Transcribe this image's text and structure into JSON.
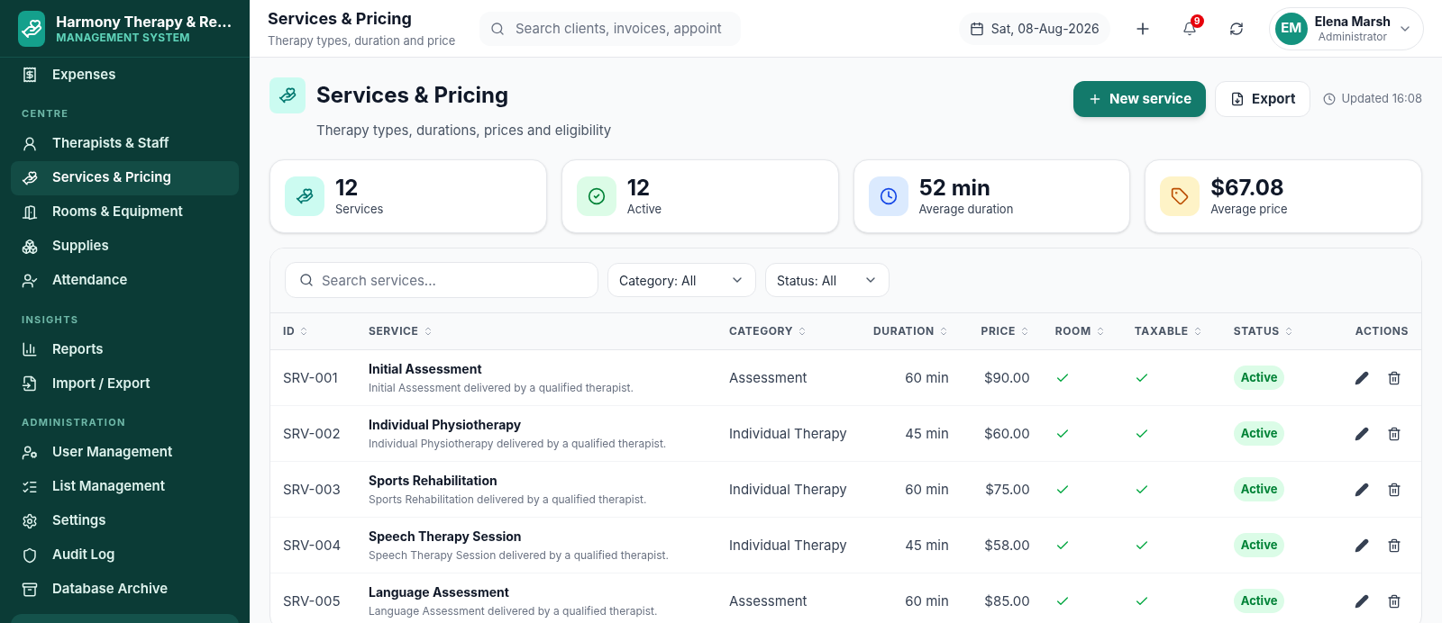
{
  "brand": {
    "name": "Harmony Therapy & Re...",
    "subtitle": "MANAGEMENT SYSTEM"
  },
  "sidebar": {
    "items": [
      {
        "kind": "item",
        "label": "Expenses",
        "selected": false
      },
      {
        "kind": "section",
        "label": "CENTRE"
      },
      {
        "kind": "item",
        "label": "Therapists & Staff",
        "selected": false
      },
      {
        "kind": "item",
        "label": "Services & Pricing",
        "selected": true
      },
      {
        "kind": "item",
        "label": "Rooms & Equipment",
        "selected": false
      },
      {
        "kind": "item",
        "label": "Supplies",
        "selected": false
      },
      {
        "kind": "item",
        "label": "Attendance",
        "selected": false
      },
      {
        "kind": "section",
        "label": "INSIGHTS"
      },
      {
        "kind": "item",
        "label": "Reports",
        "selected": false
      },
      {
        "kind": "item",
        "label": "Import / Export",
        "selected": false
      },
      {
        "kind": "section",
        "label": "ADMINISTRATION"
      },
      {
        "kind": "item",
        "label": "User Management",
        "selected": false
      },
      {
        "kind": "item",
        "label": "List Management",
        "selected": false
      },
      {
        "kind": "item",
        "label": "Settings",
        "selected": false
      },
      {
        "kind": "item",
        "label": "Audit Log",
        "selected": false
      },
      {
        "kind": "item",
        "label": "Database Archive",
        "selected": false
      }
    ]
  },
  "topbar": {
    "title": "Services & Pricing",
    "subtitle": "Therapy types, duration and price",
    "search": {
      "placeholder": "Search clients, invoices, appoint"
    },
    "date": "Sat, 08-Aug-2026",
    "notifications": "9",
    "user": {
      "initials": "EM",
      "name": "Elena Marsh",
      "role": "Administrator"
    }
  },
  "page": {
    "title": "Services & Pricing",
    "subtitle": "Therapy types, durations, prices and eligibility",
    "buttons": {
      "primary": "New service",
      "secondary": "Export"
    },
    "updated": "Updated 16:08"
  },
  "stats": [
    {
      "value": "12",
      "label": "Services",
      "color": "#ccfbf1"
    },
    {
      "value": "12",
      "label": "Active",
      "color": "#dcfce7"
    },
    {
      "value": "52 min",
      "label": "Average duration",
      "color": "#dbeafe"
    },
    {
      "value": "$67.08",
      "label": "Average price",
      "color": "#fef3c7"
    }
  ],
  "filters": {
    "search": {
      "placeholder": "Search services..."
    },
    "category": "Category: All",
    "status": "Status: All"
  },
  "table": {
    "columns": [
      "ID",
      "SERVICE",
      "CATEGORY",
      "DURATION",
      "PRICE",
      "ROOM",
      "TAXABLE",
      "STATUS",
      "ACTIONS"
    ],
    "rows": [
      {
        "id": "SRV-001",
        "name": "Initial Assessment",
        "description": "Initial Assessment delivered by a qualified therapist.",
        "category": "Assessment",
        "duration": "60 min",
        "price": "$90.00",
        "room": true,
        "taxable": true,
        "status": "Active"
      },
      {
        "id": "SRV-002",
        "name": "Individual Physiotherapy",
        "description": "Individual Physiotherapy delivered by a qualified therapist.",
        "category": "Individual Therapy",
        "duration": "45 min",
        "price": "$60.00",
        "room": true,
        "taxable": true,
        "status": "Active"
      },
      {
        "id": "SRV-003",
        "name": "Sports Rehabilitation",
        "description": "Sports Rehabilitation delivered by a qualified therapist.",
        "category": "Individual Therapy",
        "duration": "60 min",
        "price": "$75.00",
        "room": true,
        "taxable": true,
        "status": "Active"
      },
      {
        "id": "SRV-004",
        "name": "Speech Therapy Session",
        "description": "Speech Therapy Session delivered by a qualified therapist.",
        "category": "Individual Therapy",
        "duration": "45 min",
        "price": "$58.00",
        "room": true,
        "taxable": true,
        "status": "Active"
      },
      {
        "id": "SRV-005",
        "name": "Language Assessment",
        "description": "Language Assessment delivered by a qualified therapist.",
        "category": "Assessment",
        "duration": "60 min",
        "price": "$85.00",
        "room": true,
        "taxable": true,
        "status": "Active"
      }
    ]
  }
}
